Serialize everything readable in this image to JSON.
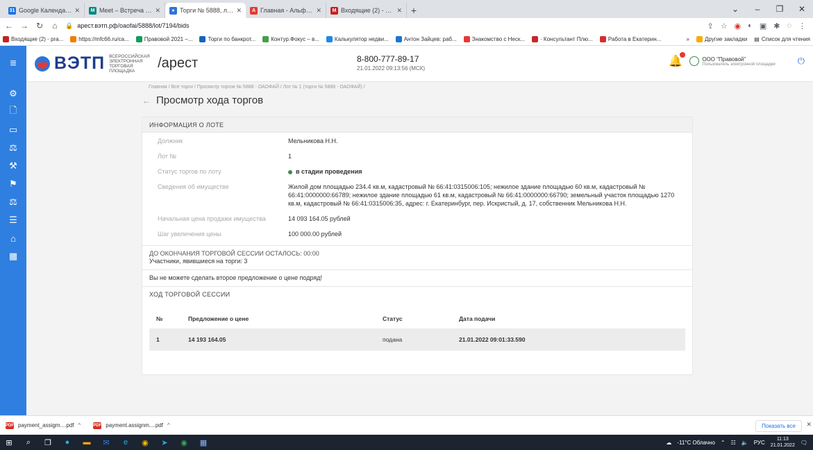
{
  "browser": {
    "tabs": [
      {
        "title": "Google Календарь - сведения о",
        "color": "#1a73e8",
        "glyph": "31",
        "active": false
      },
      {
        "title": "Meet – Встреча по ОДМБ",
        "color": "#00897b",
        "glyph": "M",
        "active": false
      },
      {
        "title": "Торги № 5888, лот № 1, жилой",
        "color": "#2d74da",
        "glyph": "●",
        "active": true
      },
      {
        "title": "Главная - Альфа-Бизнес Онлайн",
        "color": "#e53935",
        "glyph": "А",
        "active": false
      },
      {
        "title": "Входящие (2) - pravoznayka@",
        "color": "#c5221f",
        "glyph": "M",
        "active": false
      }
    ],
    "url": "apecт.вэтп.рф/oaofai/5888/lot/7194/bids",
    "bookmarks": [
      {
        "label": "Входящие (2) - pra...",
        "color": "#c5221f"
      },
      {
        "label": "https://mfc66.ru/ca...",
        "color": "#f57c00"
      },
      {
        "label": "Правовой 2021 –...",
        "color": "#0f9d58"
      },
      {
        "label": "Торги по банкрот...",
        "color": "#1565c0"
      },
      {
        "label": "Контур.Фокус – в...",
        "color": "#43a047"
      },
      {
        "label": "Калькулятор недви...",
        "color": "#1e88e5"
      },
      {
        "label": "Антон Зайцев: раб...",
        "color": "#1976d2"
      },
      {
        "label": "Знакомство с Неск...",
        "color": "#e53935"
      },
      {
        "label": "· Консультант Плю...",
        "color": "#c62828"
      },
      {
        "label": "Работа в Екатерин...",
        "color": "#d32f2f"
      }
    ],
    "bookmarks_other": "Другие закладки",
    "reading_list": "Список для чтения"
  },
  "header": {
    "logo_text": "ВЭТП",
    "logo_sub": "Всероссийская электронная торговая площадка",
    "logo_slug": "/арест",
    "phone": "8-800-777-89-17",
    "datetime": "21.01.2022 09:13:56 (МСК)",
    "user_name": "ООО \"Правовой\"",
    "user_role": "Пользователь электронной площадки"
  },
  "breadcrumb": "Главная  /  Все торги  /  Просмотр торгов № 5888 - ОАОФАЙ  /  Лот № 1 (торги № 5888 - ОАОФАЙ)  /",
  "page_title": "Просмотр хода торгов",
  "lot_info": {
    "section_title": "Информация о лоте",
    "rows": [
      {
        "k": "Должник",
        "v": "Мельникова Н.Н.",
        "bold": false,
        "dot": false
      },
      {
        "k": "Лот №",
        "v": "1",
        "bold": false,
        "dot": false
      },
      {
        "k": "Статус торгов по лоту",
        "v": "в стадии проведения",
        "bold": true,
        "dot": true
      },
      {
        "k": "Сведения об имуществе",
        "v": "Жилой дом площадью 234.4 кв.м, кадастровый № 66:41:0315006:105; нежилое здание площадью 60 кв.м, кадастровый № 66:41:0000000:66789; нежилое здание площадью 61 кв.м, кадастровый № 66:41:0000000:66790; земельный участок площадью 1270 кв.м, кадастровый № 66:41:0315006:35, адрес: г. Екатеринбург, пер. Искристый, д. 17, собственник Мельникова Н.Н.",
        "bold": false,
        "dot": false
      },
      {
        "k": "Начальная цена продажи имущества",
        "v": "14 093 164.05 рублей",
        "bold": false,
        "dot": false
      },
      {
        "k": "Шаг увеличения цены",
        "v": "100 000.00 рублей",
        "bold": false,
        "dot": false
      }
    ]
  },
  "session": {
    "remaining": "ДО ОКОНЧАНИЯ ТОРГОВОЙ СЕССИИ ОСТАЛОСЬ: 00:00",
    "participants": "Участники, явившиеся на торги: 3",
    "warning": "Вы не можете сделать второе предложение о цене подряд!",
    "section_title": "Ход торговой сессии",
    "columns": [
      "№",
      "Предложение о цене",
      "Статус",
      "Дата подачи"
    ],
    "rows": [
      {
        "n": "1",
        "price": "14 193 164.05",
        "status": "подана",
        "date": "21.01.2022 09:01:33.590"
      }
    ]
  },
  "downloads": {
    "files": [
      "payment_assigm....pdf",
      "payment.assignm....pdf"
    ],
    "show_all": "Показать все"
  },
  "taskbar": {
    "weather": "-11°С Облачно",
    "lang": "РУС",
    "time": "11:13",
    "date": "21.01.2022"
  }
}
